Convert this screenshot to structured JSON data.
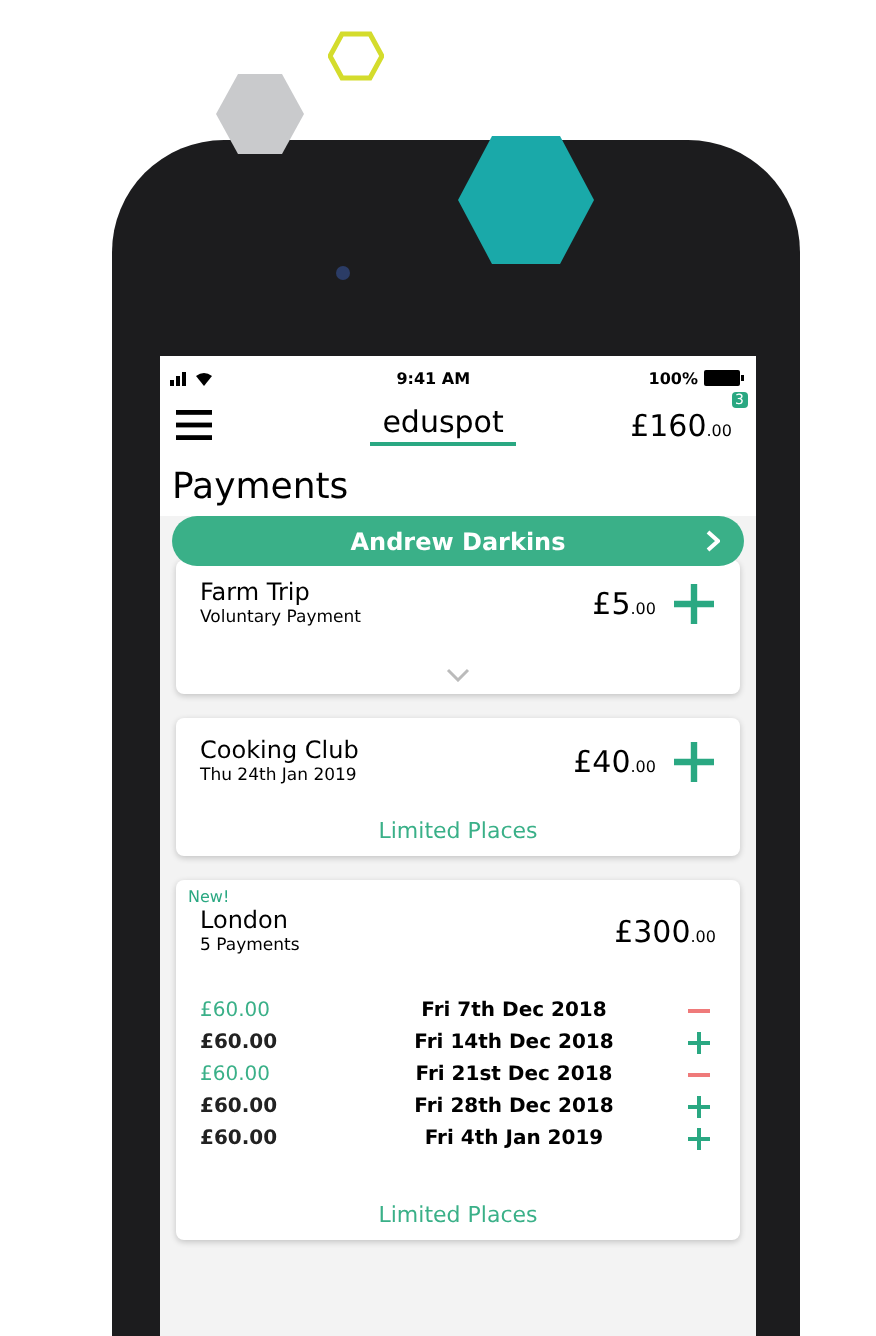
{
  "status_bar": {
    "time": "9:41 AM",
    "battery": "100%"
  },
  "header": {
    "logo": "eduspot",
    "balance": "£160",
    "balance_pence": ".00",
    "badge": "3"
  },
  "title": "Payments",
  "pupil_button": {
    "label": "Andrew Darkins"
  },
  "payments": [
    {
      "kind": "single",
      "title": "Farm Trip",
      "subtitle": "Voluntary Payment",
      "amount": "£5",
      "pence": ".00",
      "expandable": true
    },
    {
      "kind": "single",
      "title": "Cooking Club",
      "subtitle": "Thu 24th Jan 2019",
      "amount": "£40",
      "pence": ".00",
      "note": "Limited Places"
    },
    {
      "kind": "instalments",
      "flag": "New!",
      "title": "London",
      "subtitle": "5 Payments",
      "amount": "£300",
      "pence": ".00",
      "note": "Limited Places",
      "instalments": [
        {
          "amount": "£60.00",
          "date": "Fri 7th Dec 2018",
          "selected": true
        },
        {
          "amount": "£60.00",
          "date": "Fri 14th Dec 2018",
          "selected": false
        },
        {
          "amount": "£60.00",
          "date": "Fri 21st Dec 2018",
          "selected": true
        },
        {
          "amount": "£60.00",
          "date": "Fri 28th Dec 2018",
          "selected": false
        },
        {
          "amount": "£60.00",
          "date": "Fri 4th Jan 2019",
          "selected": false
        }
      ]
    }
  ]
}
